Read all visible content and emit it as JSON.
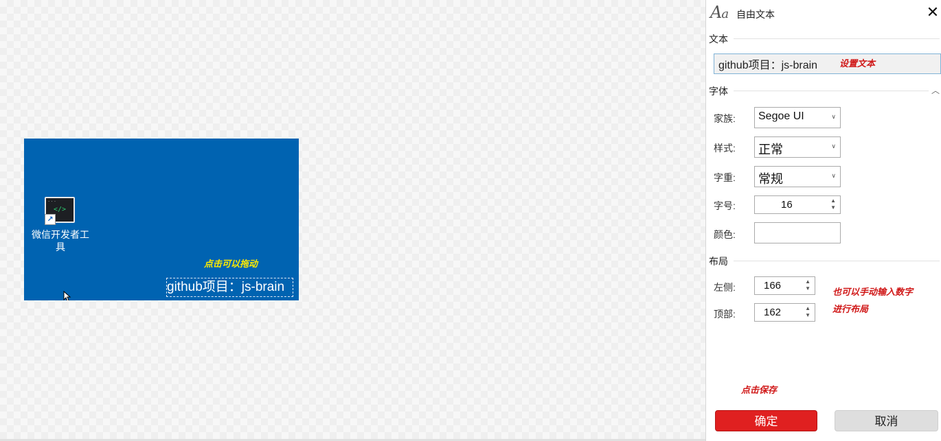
{
  "canvas": {
    "desktop_icon_label": "微信开发者工具",
    "desktop_icon_code": "</>",
    "drag_hint": "点击可以拖动",
    "free_text": "github项目：js-brain"
  },
  "panel": {
    "title": "自由文本",
    "title_icon": "font-aa-icon",
    "close_glyph": "✕",
    "sections": {
      "text": "文本",
      "font": "字体",
      "layout": "布局"
    },
    "text_value": "github项目：js-brain",
    "annotation_set_text": "设置文本",
    "font": {
      "family_label": "家族:",
      "family_value": "Segoe UI",
      "style_label": "样式:",
      "style_value": "正常",
      "weight_label": "字重:",
      "weight_value": "常规",
      "size_label": "字号:",
      "size_value": "16",
      "color_label": "颜色:",
      "color_value": "#ffffff"
    },
    "layout": {
      "left_label": "左侧:",
      "left_value": "166",
      "top_label": "顶部:",
      "top_value": "162"
    },
    "annotation_layout_line1": "也可以手动输入数字",
    "annotation_layout_line2": "进行布局",
    "annotation_save": "点击保存",
    "ok_label": "确定",
    "cancel_label": "取消"
  },
  "colors": {
    "accent_red": "#e02020",
    "desktop_blue": "#0063b1",
    "hint_yellow": "#ffeb00",
    "annotation_red": "#d01818"
  }
}
